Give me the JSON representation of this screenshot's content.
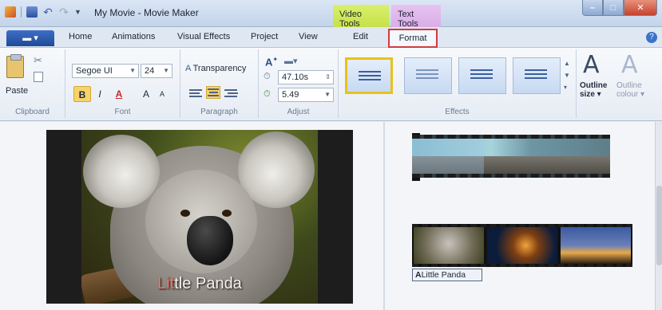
{
  "window": {
    "title": "My Movie - Movie Maker",
    "context_tabs": {
      "video_tools": "Video Tools",
      "text_tools": "Text Tools"
    },
    "buttons": {
      "minimize": "–",
      "maximize": "□",
      "close": "✕"
    }
  },
  "tabs": [
    {
      "label": "Home"
    },
    {
      "label": "Animations"
    },
    {
      "label": "Visual Effects"
    },
    {
      "label": "Project"
    },
    {
      "label": "View"
    },
    {
      "label": "Edit"
    },
    {
      "label": "Format",
      "active": true
    }
  ],
  "ribbon": {
    "clipboard": {
      "paste": "Paste",
      "label": "Clipboard"
    },
    "font": {
      "family": "Segoe UI",
      "size": "24",
      "bold": "B",
      "italic": "I",
      "color": "A",
      "grow": "A",
      "shrink": "A",
      "label": "Font"
    },
    "paragraph": {
      "transparency": "Transparency",
      "label": "Paragraph"
    },
    "adjust": {
      "start_time": "47.10s",
      "duration": "5.49",
      "label": "Adjust"
    },
    "effects": {
      "label": "Effects"
    },
    "outline": {
      "size_line1": "Outline",
      "size_line2": "size",
      "colour_line1": "Outline",
      "colour_line2": "colour"
    }
  },
  "preview": {
    "caption_part1": "Lit",
    "caption_part2": "tle Panda"
  },
  "storyboard": {
    "caption_chip": "Little Panda"
  },
  "colors": {
    "accent_red": "#d23b3b",
    "selected_effect": "#e6c21a",
    "video_tools": "#c7e04a",
    "text_tools": "#d9aee7"
  }
}
